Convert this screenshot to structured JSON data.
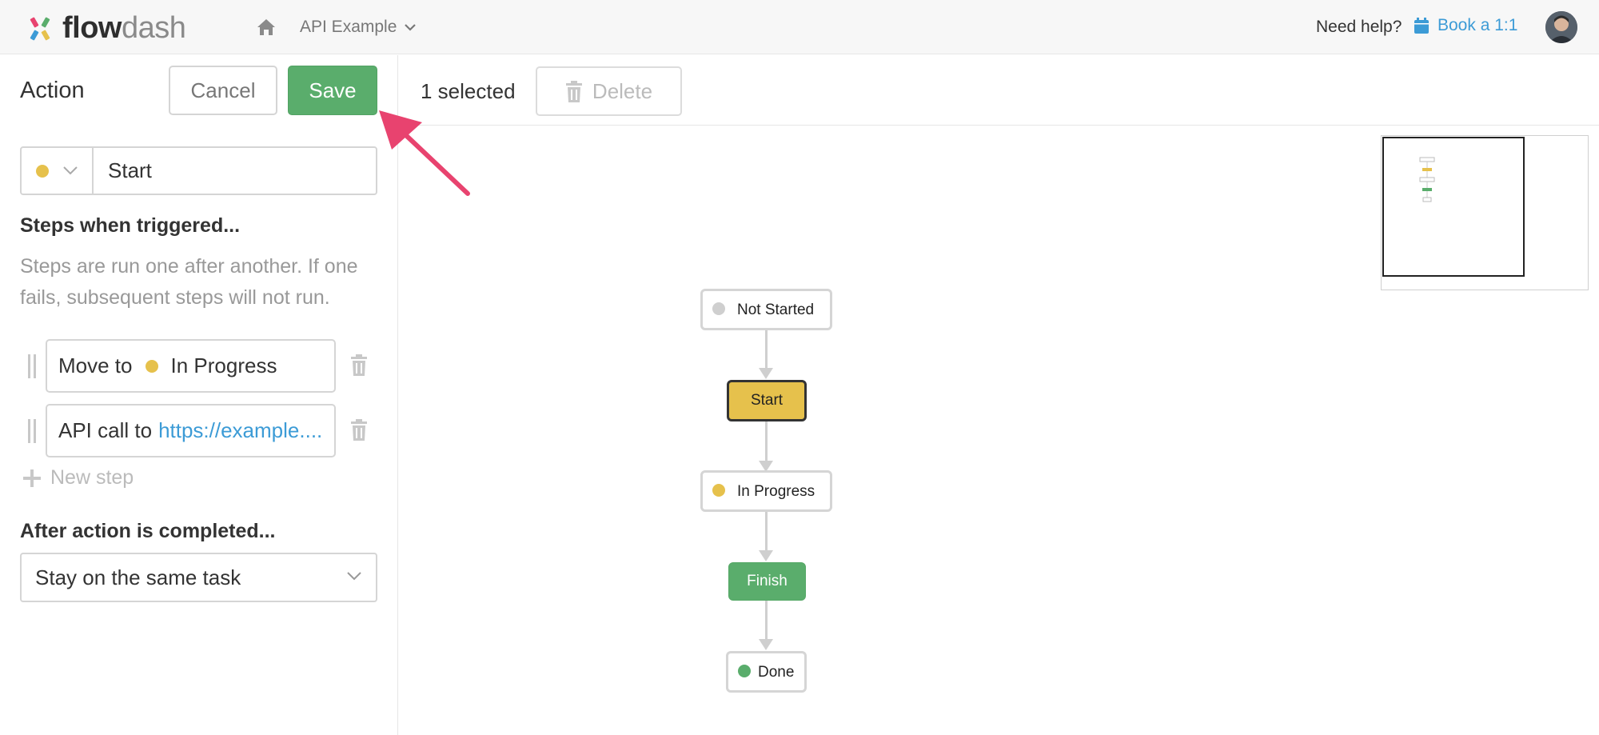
{
  "topbar": {
    "brand_bold": "flow",
    "brand_light": "dash",
    "project_name": "API Example",
    "help_text": "Need help?",
    "book_label": "Book a 1:1"
  },
  "panel": {
    "title": "Action",
    "cancel_label": "Cancel",
    "save_label": "Save",
    "action_name": "Start",
    "action_color": "#e6c14c",
    "steps_heading": "Steps when triggered...",
    "steps_description": "Steps are run one after another. If one fails, subsequent steps will not run.",
    "steps": [
      {
        "prefix": "Move to",
        "target": "In Progress",
        "target_color": "#e6c14c"
      },
      {
        "prefix": "API call to",
        "link": "https://example...."
      }
    ],
    "new_step_label": "New step",
    "after_heading": "After action is completed...",
    "after_value": "Stay on the same task"
  },
  "canvas": {
    "selected_text": "1 selected",
    "delete_label": "Delete",
    "nodes": [
      {
        "label": "Not Started",
        "kind": "state",
        "color": "#cfcfcf"
      },
      {
        "label": "Start",
        "kind": "action",
        "color": "#e6c14c"
      },
      {
        "label": "In Progress",
        "kind": "state",
        "color": "#e6c14c"
      },
      {
        "label": "Finish",
        "kind": "action",
        "color": "#5aad6c"
      },
      {
        "label": "Done",
        "kind": "state",
        "color": "#5aad6c"
      }
    ]
  },
  "colors": {
    "save_green": "#5aad6c",
    "link_blue": "#3c9bd6",
    "arrow_pink": "#e8436f"
  },
  "icons": [
    "home-icon",
    "chevron-down-icon",
    "calendar-icon",
    "trash-icon",
    "drag-handle-icon",
    "plus-icon"
  ]
}
